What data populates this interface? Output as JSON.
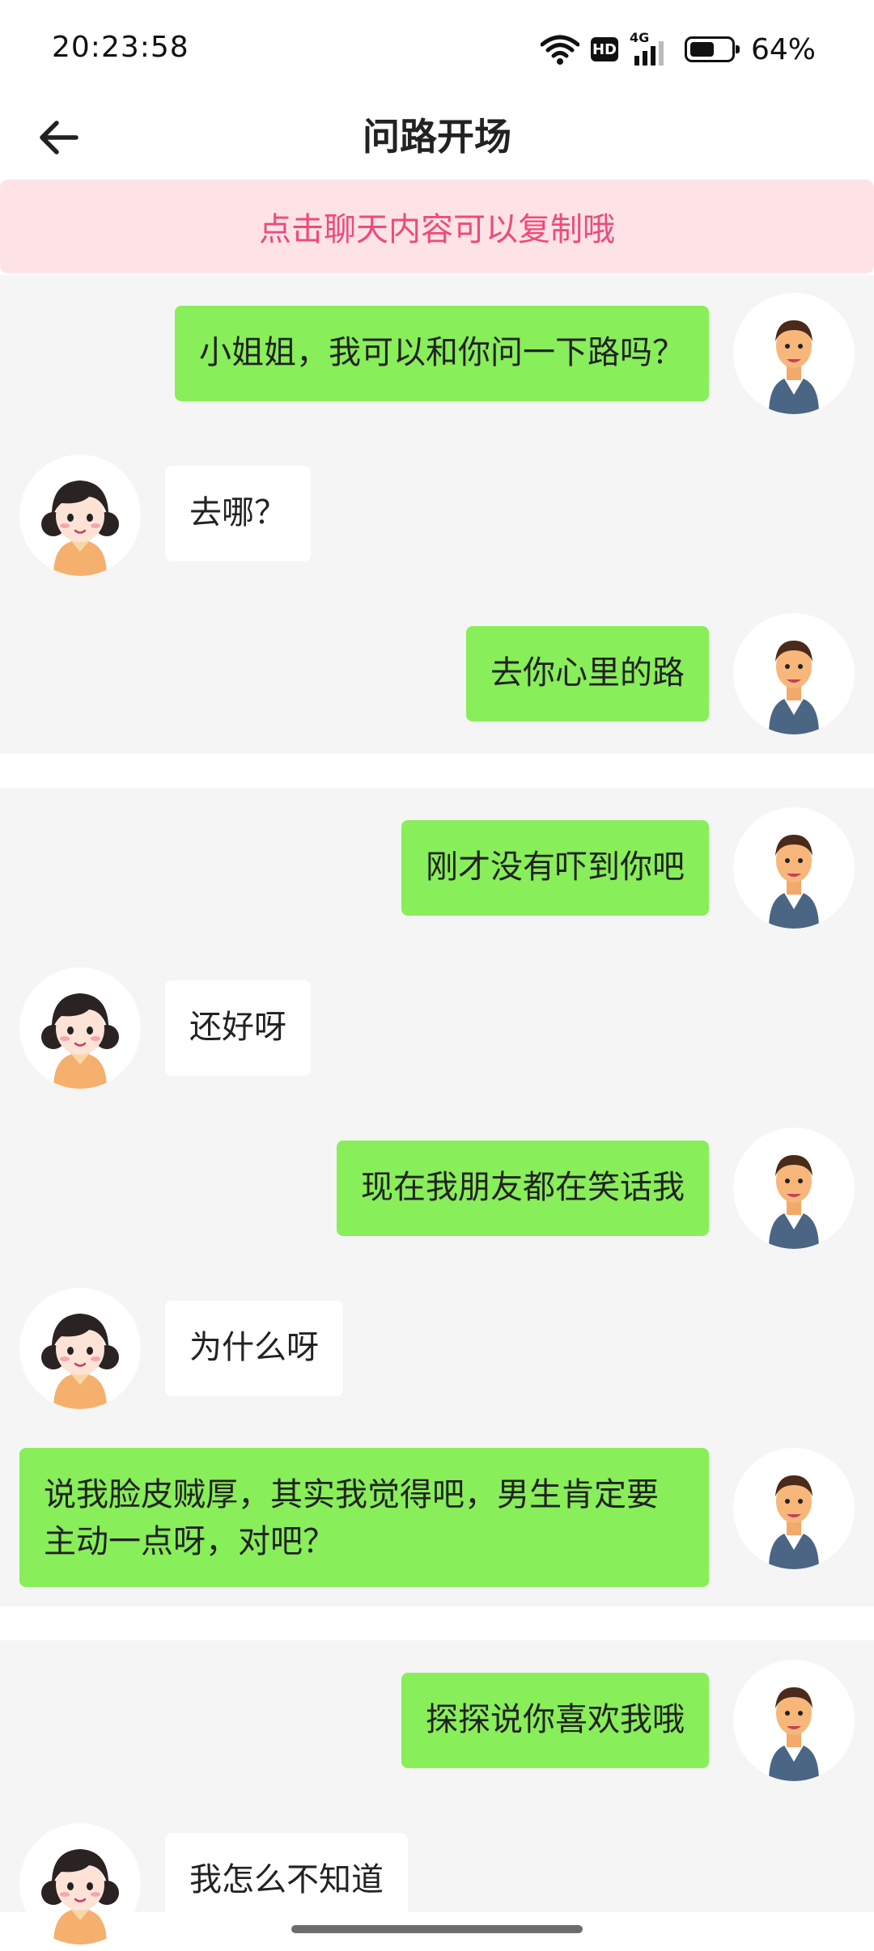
{
  "status_bar": {
    "time": "20:23:58",
    "network_label": "4G",
    "hd_label": "HD",
    "battery_percent_text": "64%",
    "battery_level": 0.64
  },
  "header": {
    "title": "问路开场",
    "back_icon": "arrow-left-icon"
  },
  "notice": {
    "text": "点击聊天内容可以复制哦",
    "color": "#ee4a7a",
    "background": "#fde3e6"
  },
  "colors": {
    "my_bubble": "#88ee5a",
    "her_bubble": "#ffffff",
    "chat_background": "#f5f5f5"
  },
  "groups": [
    {
      "messages": [
        {
          "sender": "me",
          "text": "小姐姐，我可以和你问一下路吗？"
        },
        {
          "sender": "her",
          "text": "去哪？"
        },
        {
          "sender": "me",
          "text": "去你心里的路"
        }
      ]
    },
    {
      "messages": [
        {
          "sender": "me",
          "text": "刚才没有吓到你吧"
        },
        {
          "sender": "her",
          "text": "还好呀"
        },
        {
          "sender": "me",
          "text": "现在我朋友都在笑话我"
        },
        {
          "sender": "her",
          "text": "为什么呀"
        },
        {
          "sender": "me",
          "text": "说我脸皮贼厚，其实我觉得吧，男生肯定要主动一点呀，对吧？"
        }
      ]
    },
    {
      "messages": [
        {
          "sender": "me",
          "text": "探探说你喜欢我哦"
        },
        {
          "sender": "her",
          "text": "我怎么不知道"
        }
      ]
    }
  ]
}
